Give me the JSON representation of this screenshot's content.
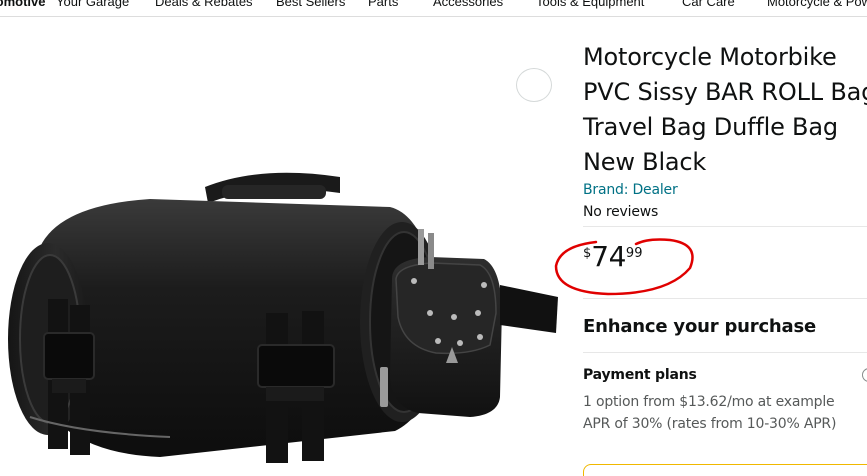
{
  "nav": {
    "items": [
      "Automotive",
      "Your Garage",
      "Deals & Rebates",
      "Best Sellers",
      "Parts",
      "Accessories",
      "Tools & Equipment",
      "Car Care",
      "Motorcycle & Powersports"
    ]
  },
  "product": {
    "title": "Motorcycle Motorbike PVC Sissy BAR ROLL Bag Travel Bag Duffle Bag New Black",
    "brand_link": "Brand: Dealer",
    "reviews": "No reviews",
    "price": {
      "symbol": "$",
      "whole": "74",
      "fraction": "99"
    },
    "annotation_color": "#e00000"
  },
  "purchase": {
    "enhance_heading": "Enhance your purchase",
    "payment_plans_heading": "Payment plans",
    "payment_plans_text": "1 option from $13.62/mo at example APR of 30% (rates from 10-30% APR)"
  },
  "colors": {
    "link": "#007185",
    "text": "#0f1111",
    "muted": "#565959",
    "accent_border": "#f0b800"
  },
  "icons": {
    "share": "share-icon",
    "product_image": "motorcycle-roll-bag-image"
  }
}
